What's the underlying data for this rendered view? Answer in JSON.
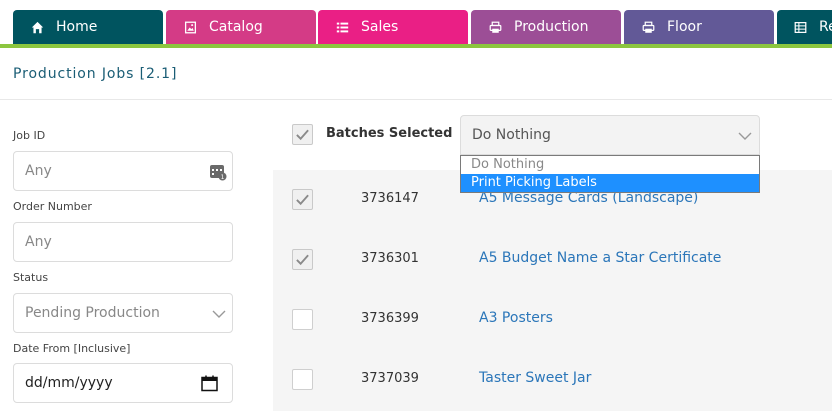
{
  "nav": {
    "tabs": [
      {
        "label": "Home",
        "icon": "home-icon",
        "color": "#00545f"
      },
      {
        "label": "Catalog",
        "icon": "image-icon",
        "color": "#d43b86"
      },
      {
        "label": "Sales",
        "icon": "list-icon",
        "color": "#ea1f85"
      },
      {
        "label": "Production",
        "icon": "printer-icon",
        "color": "#9c4e96"
      },
      {
        "label": "Floor",
        "icon": "printer-icon",
        "color": "#625997"
      },
      {
        "label": "Re",
        "icon": "table-icon",
        "color": "#00545f"
      }
    ],
    "accent_color": "#8cc63f"
  },
  "page": {
    "title": "Production Jobs [2.1]"
  },
  "filters": {
    "job_id": {
      "label": "Job ID",
      "placeholder": "Any"
    },
    "order_number": {
      "label": "Order Number",
      "placeholder": "Any"
    },
    "status": {
      "label": "Status",
      "value": "Pending Production"
    },
    "date_from": {
      "label": "Date From [Inclusive]",
      "value": "dd/mm/yyyy"
    }
  },
  "batch": {
    "label": "Batches Selected",
    "checked": true,
    "action_value": "Do Nothing",
    "options": [
      "Do Nothing",
      "Print Picking Labels"
    ],
    "highlighted_option": "Print Picking Labels"
  },
  "jobs": [
    {
      "id": "3736147",
      "title": "A5 Message Cards (Landscape)",
      "checked": true
    },
    {
      "id": "3736301",
      "title": "A5 Budget Name a Star Certificate",
      "checked": true
    },
    {
      "id": "3736399",
      "title": "A3 Posters",
      "checked": false
    },
    {
      "id": "3737039",
      "title": "Taster Sweet Jar",
      "checked": false
    }
  ]
}
